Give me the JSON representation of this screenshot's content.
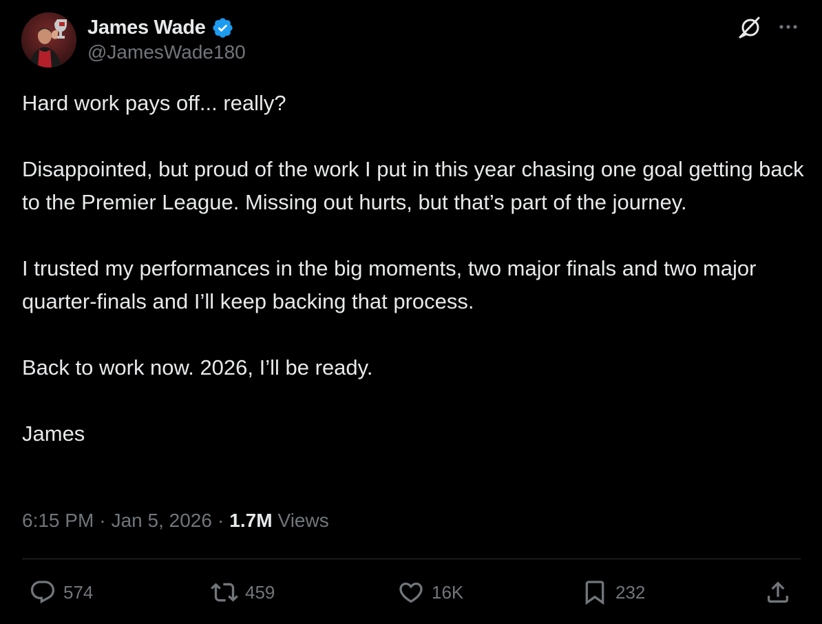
{
  "author": {
    "display_name": "James Wade",
    "handle": "@JamesWade180",
    "verified": true
  },
  "icons": {
    "avatar": "avatar-photo",
    "verified": "verified-badge-icon",
    "grok": "grok-icon",
    "more": "more-options-icon",
    "reply": "reply-icon",
    "repost": "repost-icon",
    "like": "like-heart-icon",
    "bookmark": "bookmark-icon",
    "share": "share-icon"
  },
  "tweet": {
    "paragraphs": [
      "Hard work pays off... really?",
      "Disappointed, but proud of the work I put in this year chasing one goal getting back to the Premier League. Missing out hurts, but that’s part of the journey.",
      "I trusted my performances in the big moments, two major finals and two major quarter-finals and I’ll keep backing that process.",
      "Back to work now. 2026, I’ll be ready.",
      "James"
    ]
  },
  "meta": {
    "time": "6:15 PM",
    "separator": "·",
    "date": "Jan 5, 2026",
    "views_count": "1.7M",
    "views_label": "Views"
  },
  "actions": {
    "replies": "574",
    "reposts": "459",
    "likes": "16K",
    "bookmarks": "232"
  },
  "colors": {
    "background": "#000000",
    "text_primary": "#e7e9ea",
    "text_secondary": "#71767b",
    "divider": "#2f3336",
    "verified_blue": "#1d9bf0"
  }
}
